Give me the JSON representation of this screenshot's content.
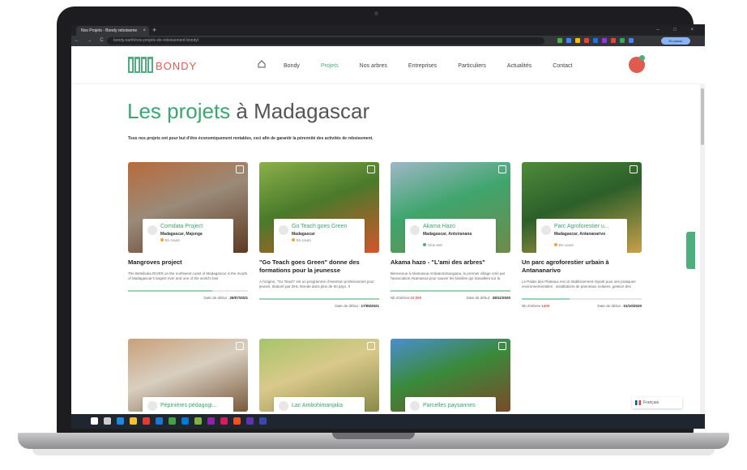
{
  "browser": {
    "tab_title": "Nos Projets - Bondy reboiseme",
    "tab_close": "×",
    "new_tab": "+",
    "window_controls": "– □ ×",
    "nav_buttons": "← → C",
    "url": "bondy.earth/nos-projets-de-reboisement-bondy/",
    "profile_label": "En pause"
  },
  "site": {
    "logo_text": "BONDY",
    "nav": [
      "Bondy",
      "Projets",
      "Nos arbres",
      "Entreprises",
      "Particuliers",
      "Actualités",
      "Contact"
    ],
    "active_nav": "Projets",
    "page_title_prefix": "Les projets ",
    "page_title_suffix": "à Madagascar",
    "intro": "Tous nos projets ont pour but d'être économiquement rentables, ceci afin de garantir la pérennité des activités de reboisement."
  },
  "cards": [
    {
      "name": "Comdata Project",
      "location": "Madagascar, Majunga",
      "status": "En cours",
      "title": "Mangroves project",
      "desc": "The Betsiboka RIVER on the northwest coast of Madagascar is the mouth of Madagascar's largest river and one of the world's fast",
      "progress": 0.7,
      "trees": "",
      "date_label": "Date de début :",
      "date": "28/07/2021",
      "colors": [
        "#b86b3c",
        "#5e3a22",
        "#9a8a78"
      ]
    },
    {
      "name": "Go Teach goes Green",
      "location": "Madagascar",
      "status": "En cours",
      "title": "\"Go Teach goes Green\" donne des formations pour la jeunesse",
      "desc": "A l'origine, \"Go Teach\" est un programme d'insertion professionnel pour jeunes, élaboré par DHL Monde dans plus de 60 pays. Il",
      "progress": 1.0,
      "trees": "",
      "date_label": "Date de début :",
      "date": "17/05/2021",
      "colors": [
        "#8bb04a",
        "#d4552c",
        "#4a7a2a"
      ]
    },
    {
      "name": "Akama Hazo",
      "location": "Madagascar, Antsiranana",
      "status": "Clos vert",
      "title": "Akama hazo - \"L'ami des arbres\"",
      "desc": "Bienvenue à Akamasoa Ambatomitsangana, le premier village créé par l'association Akamasoa pour sauver les familles qui travaillent sur la",
      "progress": 1.0,
      "trees_label": "Nb d'arbres",
      "trees": "10 000",
      "date_label": "Date de début :",
      "date": "28/11/2020",
      "colors": [
        "#9fb7c8",
        "#6f8a4a",
        "#3fa56d"
      ]
    },
    {
      "name": "Parc Agroforestier u...",
      "location": "Madagascar, Antananarivo",
      "status": "En cours",
      "title": "Un parc agroforestier urbain à Antananarivo",
      "desc": "Le Palais des Plateaux est un établissement réputé pour ses pratiques environnementales : installations de panneaux solaires, gestion des",
      "progress": 0.4,
      "trees_label": "Nb d'arbres",
      "trees": "1400",
      "date_label": "Date de début :",
      "date": "01/10/2020",
      "colors": [
        "#4f8b3a",
        "#c8a04a",
        "#2c5f2a"
      ]
    },
    {
      "name": "Pépinières pédagogi...",
      "colors": [
        "#c9a07a",
        "#7a5a3a",
        "#d8cfc0"
      ]
    },
    {
      "name": "Lac Ambohimanjaka",
      "colors": [
        "#a7c46a",
        "#8a8a4a",
        "#d9c98a"
      ]
    },
    {
      "name": "Parcelles paysannes",
      "colors": [
        "#4a8ed0",
        "#7a4a2a",
        "#3a8a3a"
      ]
    }
  ],
  "language": "Français",
  "extension_colors": [
    "#4caf50",
    "#4285f4",
    "#fbbc05",
    "#ea4335",
    "#1a73e8",
    "#9334e6",
    "#ea4335",
    "#34a853",
    "#4285f4"
  ],
  "taskbar_colors": [
    "#ffffff",
    "#cccccc",
    "#1e88e5",
    "#fbc02d",
    "#e53935",
    "#1976d2",
    "#43a047",
    "#0078d4",
    "#7cb342",
    "#8e24aa",
    "#d81b60",
    "#f4511e",
    "#5e35b1",
    "#3949ab"
  ]
}
